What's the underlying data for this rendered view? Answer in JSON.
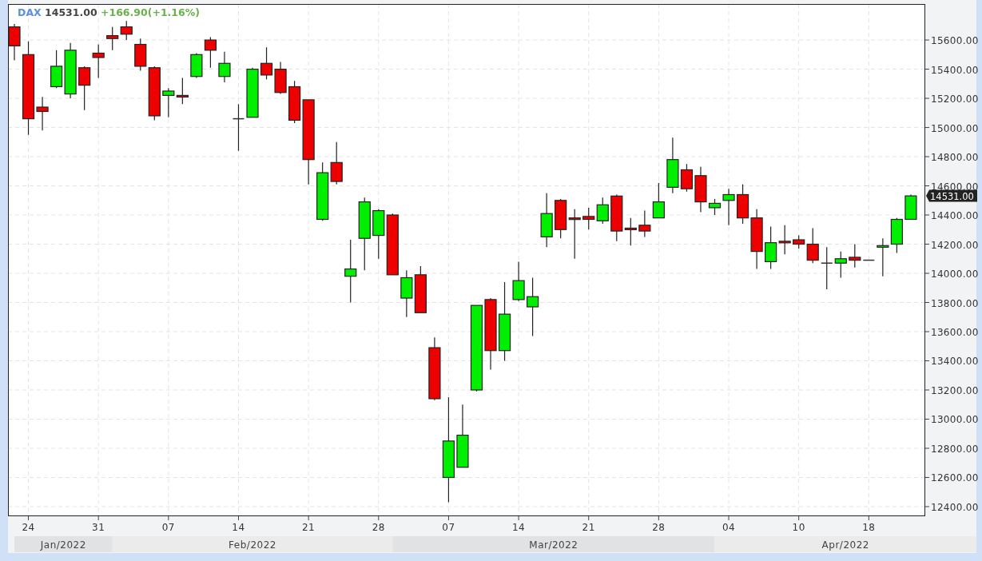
{
  "header": {
    "symbol": "DAX",
    "price": "14531.00",
    "change": "+166.90(+1.16%)"
  },
  "last_price_tag": "14531.00",
  "month_bands": [
    "Jan/2022",
    "Feb/2022",
    "Mar/2022",
    "Apr/2022"
  ],
  "chart_data": {
    "type": "candlestick",
    "grid": true,
    "ylim": [
      12334,
      15847
    ],
    "categories": [
      null,
      "24",
      null,
      null,
      null,
      null,
      "31",
      null,
      null,
      null,
      null,
      "07",
      null,
      null,
      null,
      null,
      "14",
      null,
      null,
      null,
      null,
      "21",
      null,
      null,
      null,
      null,
      "28",
      null,
      null,
      null,
      null,
      "07",
      null,
      null,
      null,
      null,
      "14",
      null,
      null,
      null,
      null,
      "21",
      null,
      null,
      null,
      null,
      "28",
      null,
      null,
      null,
      null,
      "04",
      null,
      null,
      null,
      null,
      "10",
      null,
      null,
      null,
      null,
      "18",
      null,
      null,
      null
    ],
    "yticks": [
      {
        "value": 12400,
        "label": "12400.00"
      },
      {
        "value": 12600,
        "label": "12600.00"
      },
      {
        "value": 12800,
        "label": "12800.00"
      },
      {
        "value": 13000,
        "label": "13000.00"
      },
      {
        "value": 13200,
        "label": "13200.00"
      },
      {
        "value": 13400,
        "label": "13400.00"
      },
      {
        "value": 13600,
        "label": "13600.00"
      },
      {
        "value": 13800,
        "label": "13800.00"
      },
      {
        "value": 14000,
        "label": "14000.00"
      },
      {
        "value": 14200,
        "label": "14200.00"
      },
      {
        "value": 14400,
        "label": "14400.00"
      },
      {
        "value": 14600,
        "label": "14600.00"
      },
      {
        "value": 14800,
        "label": "14800.00"
      },
      {
        "value": 15000,
        "label": "15000.00"
      },
      {
        "value": 15200,
        "label": "15200.00"
      },
      {
        "value": 15400,
        "label": "15400.00"
      },
      {
        "value": 15600,
        "label": "15600.00"
      }
    ],
    "ohlc": [
      [
        15690,
        15710,
        15460,
        15560
      ],
      [
        15500,
        15590,
        14950,
        15060
      ],
      [
        15140,
        15210,
        14980,
        15110
      ],
      [
        15280,
        15530,
        15270,
        15420
      ],
      [
        15230,
        15580,
        15200,
        15530
      ],
      [
        15410,
        15420,
        15120,
        15290
      ],
      [
        15510,
        15570,
        15340,
        15480
      ],
      [
        15630,
        15690,
        15530,
        15610
      ],
      [
        15690,
        15730,
        15600,
        15640
      ],
      [
        15570,
        15610,
        15390,
        15420
      ],
      [
        15410,
        15420,
        15050,
        15080
      ],
      [
        15220,
        15270,
        15070,
        15250
      ],
      [
        15220,
        15340,
        15160,
        15210
      ],
      [
        15350,
        15510,
        15340,
        15500
      ],
      [
        15600,
        15620,
        15410,
        15530
      ],
      [
        15350,
        15520,
        15310,
        15440
      ],
      [
        15060,
        15160,
        14840,
        15060
      ],
      [
        15070,
        15410,
        15070,
        15400
      ],
      [
        15440,
        15550,
        15330,
        15360
      ],
      [
        15400,
        15450,
        15230,
        15240
      ],
      [
        15280,
        15320,
        15030,
        15050
      ],
      [
        15190,
        15190,
        14610,
        14780
      ],
      [
        14370,
        14760,
        14360,
        14690
      ],
      [
        14760,
        14900,
        14610,
        14630
      ],
      [
        13980,
        14230,
        13800,
        14030
      ],
      [
        14240,
        14520,
        14020,
        14490
      ],
      [
        14260,
        14440,
        14100,
        14430
      ],
      [
        14400,
        14410,
        13990,
        13990
      ],
      [
        13830,
        14020,
        13700,
        13970
      ],
      [
        13990,
        14050,
        13730,
        13730
      ],
      [
        13490,
        13560,
        13130,
        13140
      ],
      [
        12600,
        13150,
        12430,
        12850
      ],
      [
        12670,
        13100,
        12670,
        12890
      ],
      [
        13200,
        13780,
        13190,
        13780
      ],
      [
        13820,
        13830,
        13340,
        13470
      ],
      [
        13470,
        13940,
        13400,
        13720
      ],
      [
        13820,
        14080,
        13810,
        13950
      ],
      [
        13770,
        13970,
        13570,
        13840
      ],
      [
        14250,
        14550,
        14180,
        14410
      ],
      [
        14500,
        14510,
        14240,
        14300
      ],
      [
        14380,
        14440,
        14100,
        14370
      ],
      [
        14390,
        14450,
        14300,
        14370
      ],
      [
        14360,
        14520,
        14340,
        14470
      ],
      [
        14530,
        14540,
        14220,
        14290
      ],
      [
        14310,
        14380,
        14190,
        14300
      ],
      [
        14330,
        14430,
        14250,
        14290
      ],
      [
        14380,
        14620,
        14380,
        14490
      ],
      [
        14590,
        14930,
        14550,
        14780
      ],
      [
        14710,
        14750,
        14560,
        14580
      ],
      [
        14670,
        14730,
        14420,
        14490
      ],
      [
        14450,
        14510,
        14400,
        14480
      ],
      [
        14500,
        14580,
        14330,
        14540
      ],
      [
        14540,
        14610,
        14340,
        14380
      ],
      [
        14380,
        14440,
        14030,
        14150
      ],
      [
        14080,
        14320,
        14030,
        14210
      ],
      [
        14220,
        14330,
        14130,
        14210
      ],
      [
        14230,
        14260,
        14170,
        14200
      ],
      [
        14200,
        14310,
        14070,
        14090
      ],
      [
        14070,
        14180,
        13890,
        14070
      ],
      [
        14070,
        14150,
        13970,
        14100
      ],
      [
        14110,
        14200,
        14040,
        14090
      ],
      [
        14090,
        14090,
        14090,
        14090
      ],
      [
        14180,
        14240,
        13980,
        14190
      ],
      [
        14200,
        14380,
        14140,
        14370
      ],
      [
        14370,
        14540,
        14370,
        14531
      ]
    ]
  }
}
